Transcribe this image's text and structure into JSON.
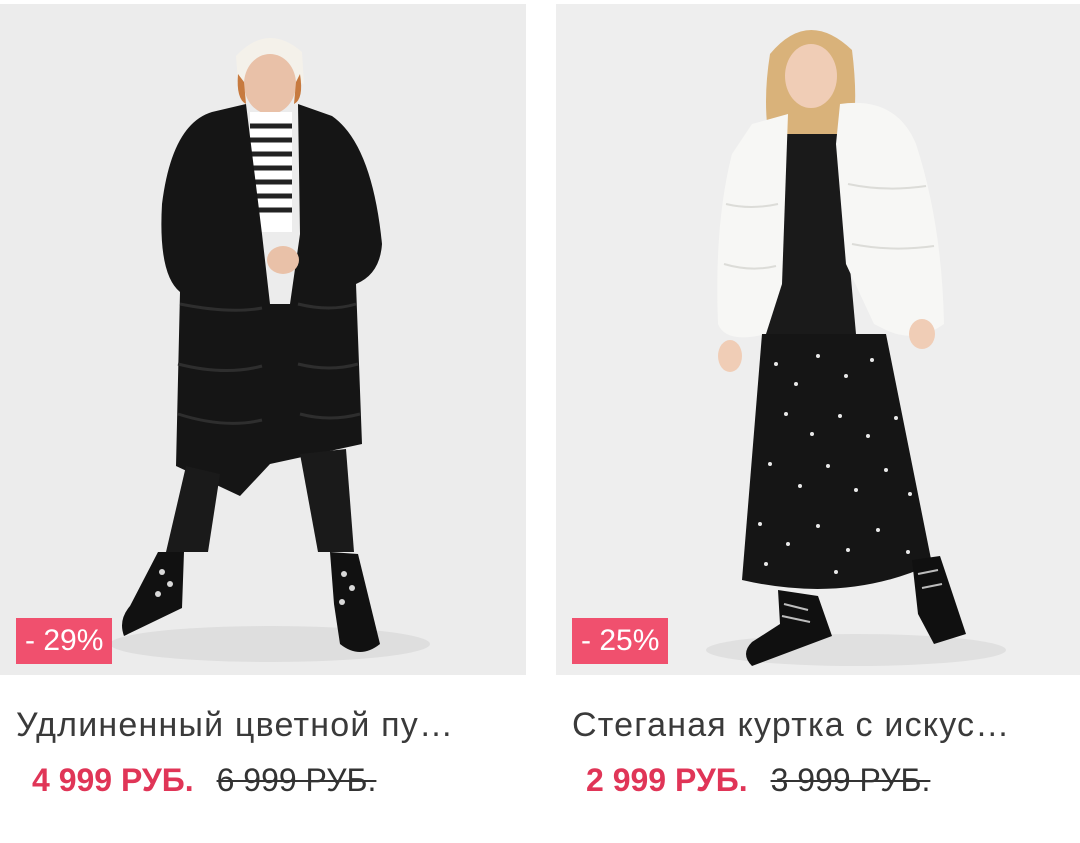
{
  "products": [
    {
      "discount": "- 29%",
      "title": "Удлиненный цветной пу…",
      "price_current": "4 999 РУБ.",
      "price_old": "6 999 РУБ."
    },
    {
      "discount": "- 25%",
      "title": "Стеганая куртка с искус…",
      "price_current": "2 999 РУБ.",
      "price_old": "3 999 РУБ."
    }
  ],
  "colors": {
    "badge": "#f0506e",
    "price_current": "#e03557",
    "photo_background": "#ececec"
  }
}
